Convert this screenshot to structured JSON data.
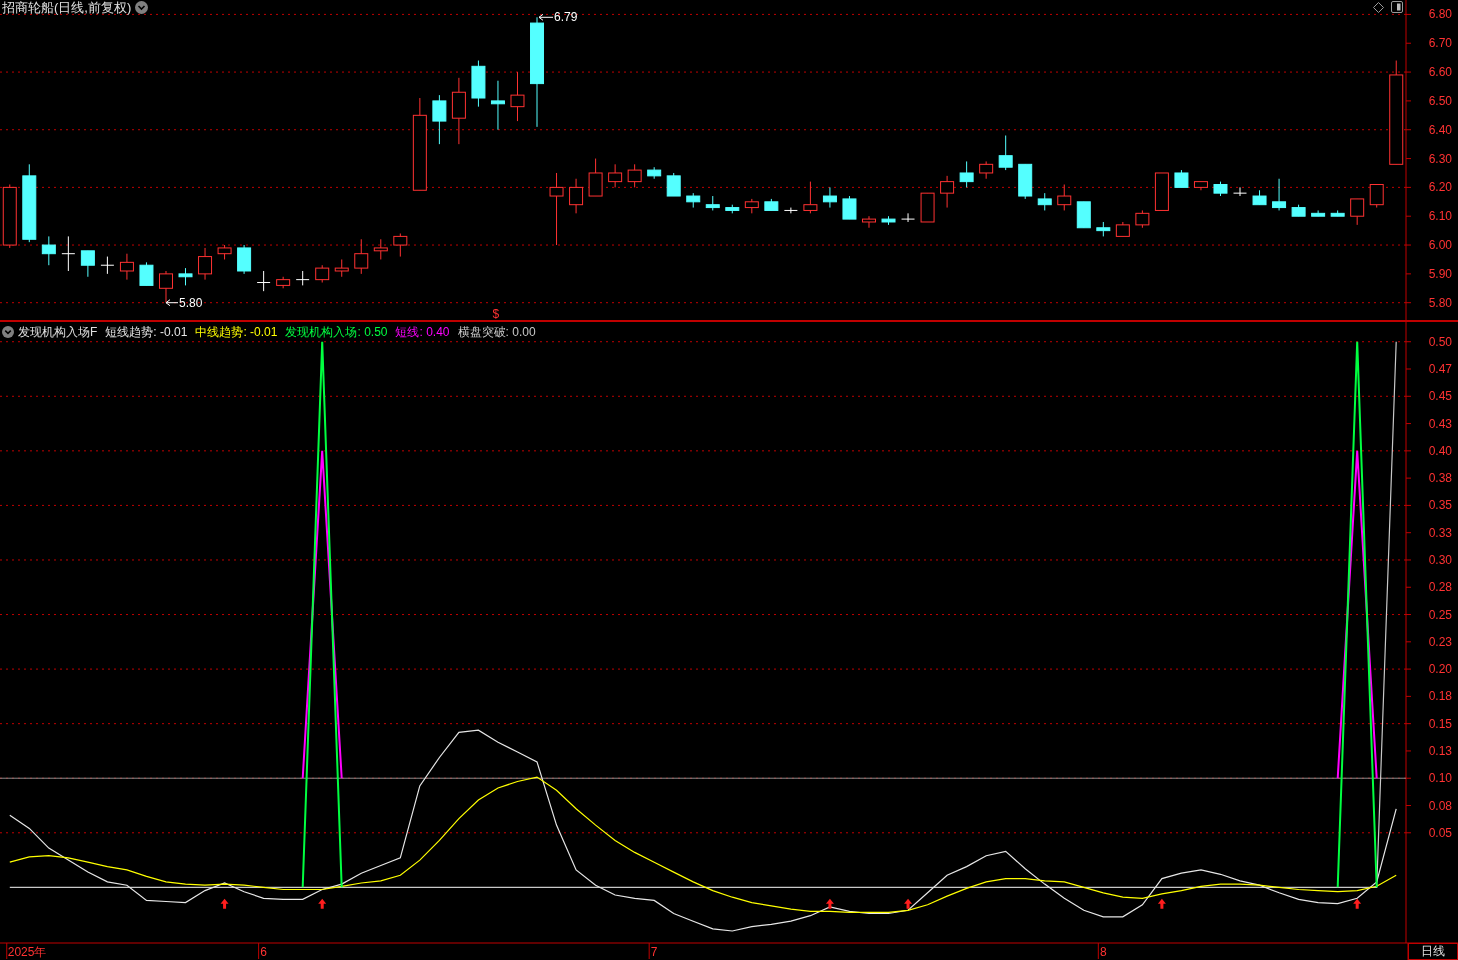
{
  "price_chart": {
    "title": "招商轮船(日线,前复权)",
    "chart_data": {
      "type": "candlestick",
      "grid": true,
      "ylim": [
        5.74,
        6.85
      ],
      "yticks": [
        {
          "value": 5.8,
          "label": "5.80"
        },
        {
          "value": 5.9,
          "label": "5.90"
        },
        {
          "value": 6.0,
          "label": "6.00"
        },
        {
          "value": 6.1,
          "label": "6.10"
        },
        {
          "value": 6.2,
          "label": "6.20"
        },
        {
          "value": 6.3,
          "label": "6.30"
        },
        {
          "value": 6.4,
          "label": "6.40"
        },
        {
          "value": 6.5,
          "label": "6.50"
        },
        {
          "value": 6.6,
          "label": "6.60"
        },
        {
          "value": 6.7,
          "label": "6.70"
        },
        {
          "value": 6.8,
          "label": "6.80"
        }
      ],
      "categories": [
        null,
        null,
        null,
        null,
        null,
        null,
        null,
        null,
        null,
        null,
        null,
        null,
        null,
        null,
        null,
        null,
        null,
        null,
        null,
        null,
        null,
        null,
        null,
        null,
        null,
        null,
        null,
        null,
        null,
        null,
        null,
        null,
        null,
        null,
        null,
        null,
        null,
        null,
        null,
        null,
        null,
        null,
        null,
        null,
        null,
        null,
        null,
        null,
        null,
        null,
        null,
        null,
        null,
        null,
        null,
        null,
        null,
        null,
        null,
        null,
        null,
        null,
        null,
        null,
        null,
        null,
        null,
        null,
        null,
        null,
        null,
        null
      ],
      "ohlc": [
        [
          6.0,
          6.21,
          5.99,
          6.2
        ],
        [
          6.24,
          6.28,
          6.01,
          6.02
        ],
        [
          6.0,
          6.03,
          5.93,
          5.97
        ],
        [
          5.97,
          6.03,
          5.91,
          5.97
        ],
        [
          5.98,
          5.98,
          5.89,
          5.93
        ],
        [
          5.93,
          5.96,
          5.9,
          5.93
        ],
        [
          5.91,
          5.97,
          5.88,
          5.94
        ],
        [
          5.93,
          5.94,
          5.86,
          5.86
        ],
        [
          5.85,
          5.91,
          5.8,
          5.9
        ],
        [
          5.9,
          5.92,
          5.86,
          5.89
        ],
        [
          5.9,
          5.99,
          5.88,
          5.96
        ],
        [
          5.97,
          6.0,
          5.95,
          5.99
        ],
        [
          5.99,
          6.0,
          5.9,
          5.91
        ],
        [
          5.87,
          5.91,
          5.84,
          5.87
        ],
        [
          5.86,
          5.89,
          5.85,
          5.88
        ],
        [
          5.88,
          5.91,
          5.86,
          5.88
        ],
        [
          5.88,
          5.93,
          5.87,
          5.92
        ],
        [
          5.91,
          5.95,
          5.89,
          5.92
        ],
        [
          5.92,
          6.02,
          5.9,
          5.97
        ],
        [
          5.98,
          6.02,
          5.95,
          5.99
        ],
        [
          6.0,
          6.04,
          5.96,
          6.03
        ],
        [
          6.19,
          6.51,
          6.19,
          6.45
        ],
        [
          6.5,
          6.52,
          6.35,
          6.43
        ],
        [
          6.44,
          6.58,
          6.35,
          6.53
        ],
        [
          6.62,
          6.64,
          6.48,
          6.51
        ],
        [
          6.5,
          6.57,
          6.4,
          6.49
        ],
        [
          6.48,
          6.6,
          6.43,
          6.52
        ],
        [
          6.77,
          6.79,
          6.41,
          6.56
        ],
        [
          6.17,
          6.25,
          6.0,
          6.2
        ],
        [
          6.14,
          6.23,
          6.11,
          6.2
        ],
        [
          6.17,
          6.3,
          6.17,
          6.25
        ],
        [
          6.22,
          6.28,
          6.2,
          6.25
        ],
        [
          6.22,
          6.28,
          6.2,
          6.26
        ],
        [
          6.26,
          6.27,
          6.23,
          6.24
        ],
        [
          6.24,
          6.25,
          6.17,
          6.17
        ],
        [
          6.17,
          6.18,
          6.13,
          6.15
        ],
        [
          6.14,
          6.17,
          6.12,
          6.13
        ],
        [
          6.13,
          6.14,
          6.11,
          6.12
        ],
        [
          6.13,
          6.16,
          6.11,
          6.15
        ],
        [
          6.15,
          6.16,
          6.12,
          6.12
        ],
        [
          6.12,
          6.13,
          6.11,
          6.12
        ],
        [
          6.12,
          6.22,
          6.11,
          6.14
        ],
        [
          6.17,
          6.2,
          6.13,
          6.15
        ],
        [
          6.16,
          6.17,
          6.09,
          6.09
        ],
        [
          6.08,
          6.1,
          6.06,
          6.09
        ],
        [
          6.09,
          6.1,
          6.07,
          6.08
        ],
        [
          6.09,
          6.11,
          6.08,
          6.09
        ],
        [
          6.08,
          6.18,
          6.08,
          6.18
        ],
        [
          6.18,
          6.24,
          6.13,
          6.22
        ],
        [
          6.25,
          6.29,
          6.2,
          6.22
        ],
        [
          6.25,
          6.29,
          6.23,
          6.28
        ],
        [
          6.31,
          6.38,
          6.26,
          6.27
        ],
        [
          6.28,
          6.28,
          6.16,
          6.17
        ],
        [
          6.16,
          6.18,
          6.12,
          6.14
        ],
        [
          6.14,
          6.21,
          6.12,
          6.17
        ],
        [
          6.15,
          6.15,
          6.06,
          6.06
        ],
        [
          6.06,
          6.08,
          6.03,
          6.05
        ],
        [
          6.03,
          6.08,
          6.03,
          6.07
        ],
        [
          6.07,
          6.12,
          6.06,
          6.11
        ],
        [
          6.12,
          6.25,
          6.12,
          6.25
        ],
        [
          6.25,
          6.26,
          6.2,
          6.2
        ],
        [
          6.2,
          6.22,
          6.19,
          6.22
        ],
        [
          6.21,
          6.22,
          6.17,
          6.18
        ],
        [
          6.18,
          6.2,
          6.17,
          6.18
        ],
        [
          6.17,
          6.19,
          6.14,
          6.14
        ],
        [
          6.15,
          6.23,
          6.12,
          6.13
        ],
        [
          6.13,
          6.14,
          6.1,
          6.1
        ],
        [
          6.11,
          6.12,
          6.1,
          6.1
        ],
        [
          6.11,
          6.12,
          6.1,
          6.1
        ],
        [
          6.1,
          6.16,
          6.07,
          6.16
        ],
        [
          6.14,
          6.21,
          6.13,
          6.21
        ],
        [
          6.28,
          6.64,
          6.28,
          6.59
        ]
      ],
      "annotations": [
        "6.79",
        "5.80",
        "$"
      ]
    }
  },
  "indicator": {
    "name": "发现机构入场F",
    "legend_separator": ":",
    "legend_values": [
      "-0.01",
      "-0.01",
      "0.50",
      "0.40",
      "0.00"
    ],
    "chart_data": {
      "type": "line",
      "grid": true,
      "ylim": [
        -0.051,
        0.519
      ],
      "yticks": [
        {
          "value": 0.5,
          "label": "0.50"
        },
        {
          "value": 0.475,
          "label": "0.47"
        },
        {
          "value": 0.45,
          "label": "0.45"
        },
        {
          "value": 0.425,
          "label": "0.43"
        },
        {
          "value": 0.4,
          "label": "0.40"
        },
        {
          "value": 0.375,
          "label": "0.38"
        },
        {
          "value": 0.35,
          "label": "0.35"
        },
        {
          "value": 0.325,
          "label": "0.33"
        },
        {
          "value": 0.3,
          "label": "0.30"
        },
        {
          "value": 0.275,
          "label": "0.28"
        },
        {
          "value": 0.25,
          "label": "0.25"
        },
        {
          "value": 0.225,
          "label": "0.23"
        },
        {
          "value": 0.2,
          "label": "0.20"
        },
        {
          "value": 0.175,
          "label": "0.18"
        },
        {
          "value": 0.15,
          "label": "0.15"
        },
        {
          "value": 0.125,
          "label": "0.13"
        },
        {
          "value": 0.1,
          "label": "0.10"
        },
        {
          "value": 0.075,
          "label": "0.08"
        },
        {
          "value": 0.05,
          "label": "0.05"
        }
      ],
      "categories": [
        null,
        null,
        null,
        null,
        null,
        null,
        null,
        null,
        null,
        null,
        null,
        null,
        null,
        "6",
        null,
        null,
        null,
        null,
        null,
        null,
        null,
        null,
        null,
        null,
        null,
        null,
        null,
        null,
        null,
        null,
        null,
        null,
        null,
        "7",
        null,
        null,
        null,
        null,
        null,
        null,
        null,
        null,
        null,
        null,
        null,
        null,
        null,
        null,
        null,
        null,
        null,
        null,
        null,
        null,
        null,
        null,
        "8",
        null,
        null,
        null,
        null,
        null,
        null,
        null,
        null,
        null,
        null,
        null,
        null,
        null,
        null,
        null
      ],
      "series": [
        {
          "name": "短线趋势",
          "color": "#e6e6e6",
          "values": [
            0.066,
            0.054,
            0.036,
            0.025,
            0.014,
            0.005,
            0.002,
            -0.012,
            -0.013,
            -0.014,
            -0.003,
            0.004,
            -0.004,
            -0.01,
            -0.011,
            -0.011,
            -0.002,
            0.003,
            0.013,
            0.02,
            0.027,
            0.093,
            0.119,
            0.142,
            0.144,
            0.133,
            0.124,
            0.115,
            0.057,
            0.016,
            0.002,
            -0.007,
            -0.01,
            -0.012,
            -0.024,
            -0.031,
            -0.038,
            -0.04,
            -0.036,
            -0.034,
            -0.031,
            -0.026,
            -0.018,
            -0.022,
            -0.024,
            -0.024,
            -0.021,
            -0.005,
            0.011,
            0.019,
            0.029,
            0.033,
            0.017,
            0.003,
            -0.01,
            -0.021,
            -0.027,
            -0.027,
            -0.016,
            0.008,
            0.013,
            0.016,
            0.012,
            0.006,
            0.002,
            -0.005,
            -0.011,
            -0.014,
            -0.015,
            -0.01,
            0.005,
            0.072
          ]
        },
        {
          "name": "中线趋势",
          "color": "#ffff00",
          "values": [
            0.023,
            0.028,
            0.029,
            0.027,
            0.023,
            0.019,
            0.016,
            0.01,
            0.005,
            0.003,
            0.002,
            0.003,
            0.002,
            0.0,
            -0.002,
            -0.002,
            -0.002,
            0.001,
            0.004,
            0.006,
            0.011,
            0.025,
            0.043,
            0.063,
            0.08,
            0.091,
            0.097,
            0.101,
            0.089,
            0.072,
            0.057,
            0.043,
            0.032,
            0.023,
            0.014,
            0.005,
            -0.003,
            -0.009,
            -0.014,
            -0.017,
            -0.02,
            -0.022,
            -0.022,
            -0.023,
            -0.023,
            -0.023,
            -0.021,
            -0.016,
            -0.008,
            -0.001,
            0.005,
            0.008,
            0.008,
            0.006,
            0.005,
            0.0,
            -0.005,
            -0.009,
            -0.01,
            -0.006,
            -0.003,
            0.001,
            0.003,
            0.003,
            0.002,
            0.0,
            -0.002,
            -0.003,
            -0.004,
            -0.003,
            0.001,
            0.011
          ]
        },
        {
          "name": "发现机构入场",
          "color": "#00ff40",
          "values": [
            null,
            null,
            null,
            null,
            null,
            null,
            null,
            null,
            null,
            null,
            null,
            null,
            null,
            null,
            null,
            0,
            0.5,
            0,
            null,
            null,
            null,
            null,
            null,
            null,
            null,
            null,
            null,
            null,
            null,
            null,
            null,
            null,
            null,
            null,
            null,
            null,
            null,
            null,
            null,
            null,
            null,
            null,
            null,
            null,
            null,
            null,
            null,
            null,
            null,
            null,
            null,
            null,
            null,
            null,
            null,
            null,
            null,
            null,
            null,
            null,
            null,
            null,
            null,
            null,
            null,
            null,
            null,
            null,
            0,
            0.5,
            0,
            null
          ]
        },
        {
          "name": "短线",
          "color": "#ff00ff",
          "values": [
            null,
            null,
            null,
            null,
            null,
            null,
            null,
            null,
            null,
            null,
            null,
            null,
            null,
            null,
            null,
            0.1,
            0.4,
            0.1,
            null,
            null,
            null,
            null,
            null,
            null,
            null,
            null,
            null,
            null,
            null,
            null,
            null,
            null,
            null,
            null,
            null,
            null,
            null,
            null,
            null,
            null,
            null,
            null,
            null,
            null,
            null,
            null,
            null,
            null,
            null,
            null,
            null,
            null,
            null,
            null,
            null,
            null,
            null,
            null,
            null,
            null,
            null,
            null,
            null,
            null,
            null,
            null,
            null,
            null,
            0.1,
            0.4,
            0.1,
            null
          ]
        },
        {
          "name": "横盘突破",
          "color": "#c8c8c8",
          "values": [
            0,
            0,
            0,
            0,
            0,
            0,
            0,
            0,
            0,
            0,
            0,
            0,
            0,
            0,
            0,
            0,
            0,
            0,
            0,
            0,
            0,
            0,
            0,
            0,
            0,
            0,
            0,
            0,
            0,
            0,
            0,
            0,
            0,
            0,
            0,
            0,
            0,
            0,
            0,
            0,
            0,
            0,
            0,
            0,
            0,
            0,
            0,
            0,
            0,
            0,
            0,
            0,
            0,
            0,
            0,
            0,
            0,
            0,
            0,
            0,
            0,
            0,
            0,
            0,
            0,
            0,
            0,
            0,
            0,
            0,
            0,
            0.5
          ]
        }
      ],
      "ref_lines": [
        {
          "axis": "y",
          "value": 0.1,
          "color": "#8a8a8a"
        }
      ]
    }
  },
  "x_axis_year": "2025年",
  "period_label": "日线"
}
